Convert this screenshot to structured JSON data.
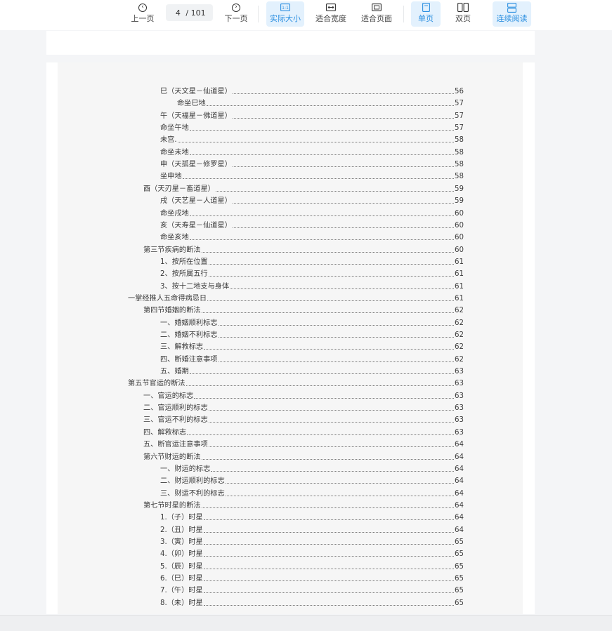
{
  "toolbar": {
    "prev_label": "上一页",
    "next_label": "下一页",
    "page_current": "4",
    "page_total": "/ 101",
    "actual_size_label": "实际大小",
    "fit_width_label": "适合宽度",
    "fit_page_label": "适合页面",
    "single_page_label": "单页",
    "double_page_label": "双页",
    "continuous_label": "连续阅读",
    "accent_color": "#2b8fe0"
  },
  "toc": [
    {
      "text": "巳（天文星－仙道星）",
      "page": "56"
    },
    {
      "text": "命坐巳地",
      "page": "57"
    },
    {
      "text": "午（天福星－佛道星）",
      "page": "57"
    },
    {
      "text": "命坐午地",
      "page": "57"
    },
    {
      "text": "未宫.",
      "page": "58"
    },
    {
      "text": "命坐未地",
      "page": "58"
    },
    {
      "text": "申（天孤星－修罗星）",
      "page": "58"
    },
    {
      "text": "坐申地",
      "page": "58"
    },
    {
      "text": "酉（天刃星－畜道星）",
      "page": "59"
    },
    {
      "text": "戌（天艺星－人道星）",
      "page": "59"
    },
    {
      "text": "命坐戌地",
      "page": "60"
    },
    {
      "text": "亥（天寿星－仙道星）",
      "page": "60"
    },
    {
      "text": "命坐亥地",
      "page": "60"
    },
    {
      "text": "第三节疾病的断法",
      "page": "60"
    },
    {
      "text": "1、按所在位置",
      "page": "61"
    },
    {
      "text": "2、按所属五行",
      "page": "61"
    },
    {
      "text": "3、按十二地支与身体",
      "page": "61"
    },
    {
      "text": "一掌经推人五命得病忌日",
      "page": "61"
    },
    {
      "text": "第四节婚姻的断法",
      "page": "62"
    },
    {
      "text": "一、婚姻顺利标志",
      "page": "62"
    },
    {
      "text": "二、婚姻不利标志",
      "page": "62"
    },
    {
      "text": "三、解救标志",
      "page": "62"
    },
    {
      "text": "四、断婚注意事项",
      "page": "62"
    },
    {
      "text": "五、婚期",
      "page": "63"
    },
    {
      "text": "第五节官运的断法",
      "page": "63"
    },
    {
      "text": "一、官运的标志",
      "page": "63"
    },
    {
      "text": "二、官运顺利的标志",
      "page": "63"
    },
    {
      "text": "三、官运不利的标志",
      "page": "63"
    },
    {
      "text": "四、解救标志",
      "page": "63"
    },
    {
      "text": "五、断官运注意事项",
      "page": "64"
    },
    {
      "text": "第六节财运的断法",
      "page": "64"
    },
    {
      "text": "一、财运的标志",
      "page": "64"
    },
    {
      "text": "二、财运顺利的标志",
      "page": "64"
    },
    {
      "text": "三、财运不利的标志",
      "page": "64"
    },
    {
      "text": "第七节时星的断法",
      "page": "64"
    },
    {
      "text": "1.（子）时星",
      "page": "64"
    },
    {
      "text": "2.（丑）时星",
      "page": "64"
    },
    {
      "text": "3.（寅）时星",
      "page": "65"
    },
    {
      "text": "4.（卯）时星",
      "page": "65"
    },
    {
      "text": "5.（辰）时星",
      "page": "65"
    },
    {
      "text": "6.（巳）时星",
      "page": "65"
    },
    {
      "text": "7.（午）时星",
      "page": "65"
    },
    {
      "text": "8.（未）时星",
      "page": "65"
    }
  ]
}
